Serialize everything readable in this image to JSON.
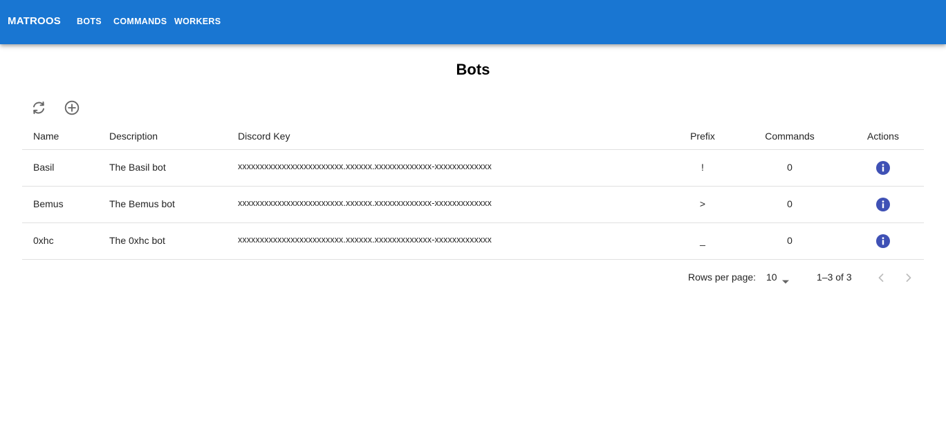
{
  "appbar": {
    "brand": "MATROOS",
    "nav": [
      "BOTS",
      "COMMANDS",
      "WORKERS"
    ],
    "color": "#1976d2"
  },
  "page": {
    "title": "Bots"
  },
  "toolbar": {
    "icons": [
      "refresh-icon",
      "add-circle-icon"
    ]
  },
  "table": {
    "headers": {
      "name": "Name",
      "description": "Description",
      "key": "Discord Key",
      "prefix": "Prefix",
      "commands": "Commands",
      "actions": "Actions"
    },
    "rows": [
      {
        "name": "Basil",
        "description": "The Basil bot",
        "key": "xxxxxxxxxxxxxxxxxxxxxxxx.xxxxxx.xxxxxxxxxxxxx-xxxxxxxxxxxxx",
        "prefix": "!",
        "commands": "0"
      },
      {
        "name": "Bemus",
        "description": "The Bemus bot",
        "key": "xxxxxxxxxxxxxxxxxxxxxxxx.xxxxxx.xxxxxxxxxxxxx-xxxxxxxxxxxxx",
        "prefix": ">",
        "commands": "0"
      },
      {
        "name": "0xhc",
        "description": "The 0xhc bot",
        "key": "xxxxxxxxxxxxxxxxxxxxxxxx.xxxxxx.xxxxxxxxxxxxx-xxxxxxxxxxxxx",
        "prefix": "_",
        "commands": "0"
      }
    ],
    "action_icon": "info-icon",
    "action_color": "#3f51b5"
  },
  "pagination": {
    "rows_label": "Rows per page:",
    "rows_value": "10",
    "range": "1–3 of 3"
  }
}
